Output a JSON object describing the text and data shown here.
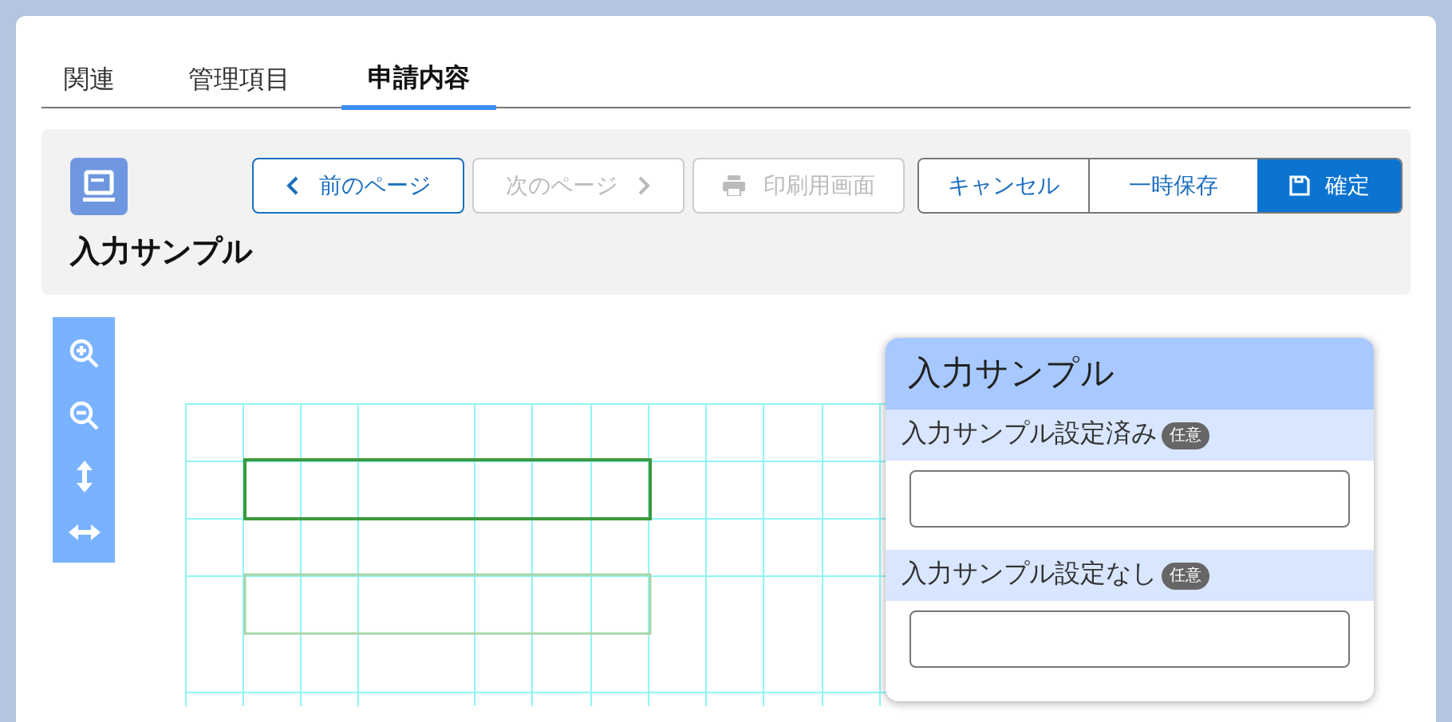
{
  "tabs": [
    {
      "label": "関連",
      "selected": false
    },
    {
      "label": "管理項目",
      "selected": false
    },
    {
      "label": "申請内容",
      "selected": true
    }
  ],
  "header": {
    "title": "入力サンプル",
    "buttons": [
      {
        "label": "前のページ",
        "kind": "prev",
        "disabled": false
      },
      {
        "label": "次のページ",
        "kind": "next",
        "disabled": true
      },
      {
        "label": "印刷用画面",
        "kind": "print",
        "disabled": true
      }
    ],
    "actions": [
      {
        "label": "キャンセル",
        "kind": "plain"
      },
      {
        "label": "一時保存",
        "kind": "plain"
      },
      {
        "label": "確定",
        "kind": "primary"
      }
    ]
  },
  "canvas": {
    "shapes": [
      {
        "selected": true
      },
      {
        "selected": false
      }
    ]
  },
  "form": {
    "title": "入力サンプル",
    "fields": [
      {
        "label": "入力サンプル設定済み",
        "badge": "任意"
      },
      {
        "label": "入力サンプル設定なし",
        "badge": "任意"
      }
    ]
  }
}
